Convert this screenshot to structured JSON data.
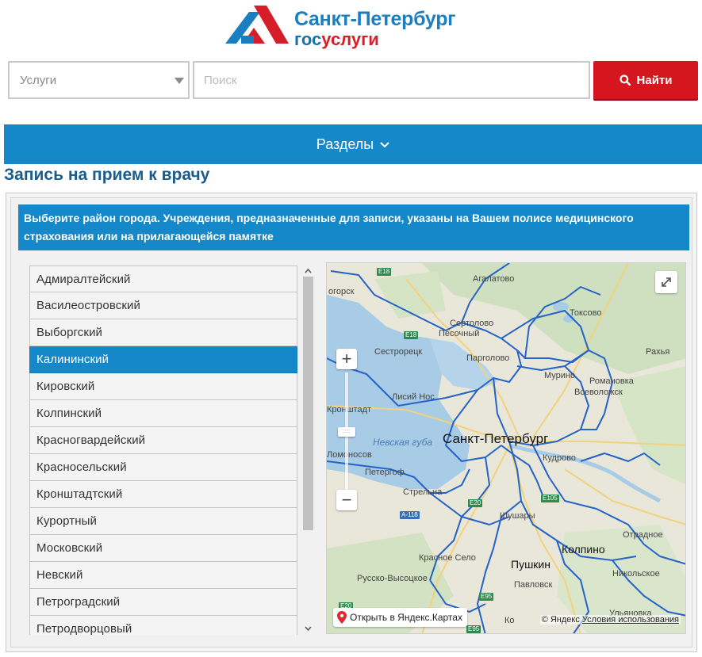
{
  "logo": {
    "line1": "Санкт-Петербург",
    "line2_gos": "гос",
    "line2_uslugi": "услуги"
  },
  "search": {
    "category_label": "Услуги",
    "placeholder": "Поиск",
    "button_label": "Найти"
  },
  "nav": {
    "sections_label": "Разделы"
  },
  "page": {
    "title": "Запись на прием к врачу",
    "info_text": "Выберите район города. Учреждения, предназначенные для записи, указаны на Вашем полисе медицинского страхования или на прилагающейся памятке"
  },
  "districts": {
    "selected": "Калининский",
    "items": [
      "Адмиралтейский",
      "Василеостровский",
      "Выборгский",
      "Калининский",
      "Кировский",
      "Колпинский",
      "Красногвардейский",
      "Красносельский",
      "Кронштадтский",
      "Курортный",
      "Московский",
      "Невский",
      "Петроградский",
      "Петродворцовый"
    ]
  },
  "map": {
    "places": {
      "spb": "Санкт-Петербург",
      "kolpino": "Колпино",
      "pushkin": "Пушкин",
      "agalatovo": "Агалатово",
      "toksovo": "Токсово",
      "sertolovo": "Сертолово",
      "pesochny": "Песочный",
      "pargolovo": "Парголово",
      "sestroretsk": "Сестрорецк",
      "murino": "Мурино",
      "romanovka": "Романовка",
      "vsevolozhsk": "Всеволожск",
      "rakhya": "Рахья",
      "lisiy_nos": "Лисий Нос",
      "kronshtadt": "Кронштадт",
      "lomonosov": "Ломоносов",
      "petergof": "Петергоф",
      "strelna": "Стрельна",
      "kudrovo": "Кудрово",
      "shushary": "Шушары",
      "krasnoe_selo": "Красное Село",
      "russko_vysotskoe": "Русско-Высоцкое",
      "pavlovsk": "Павловск",
      "otradnoe": "Отрадное",
      "nikolskoe": "Никольское",
      "zelenogorsk_partial": "огорск",
      "ulyanovka_partial": "Ульяновка",
      "neva_bay": "Невская губа"
    },
    "roads": [
      "E18",
      "E18",
      "E20",
      "A-118",
      "E105",
      "E95",
      "E95",
      "E20"
    ],
    "zoom_in": "+",
    "zoom_out": "−",
    "open_in_yandex": "Открыть в Яндекс.Картах",
    "copyright": "© Яндекс",
    "terms": "Условия использования",
    "partial_ko": "Ко"
  },
  "colors": {
    "brand_blue": "#1588c9",
    "find_red": "#d6161e",
    "title_blue": "#1a5d8c"
  },
  "icons": {
    "search": "search-icon",
    "chevron": "chevron-down-icon",
    "dropdown": "caret-down-icon",
    "fullscreen": "fullscreen-icon",
    "pin": "map-pin-icon"
  }
}
